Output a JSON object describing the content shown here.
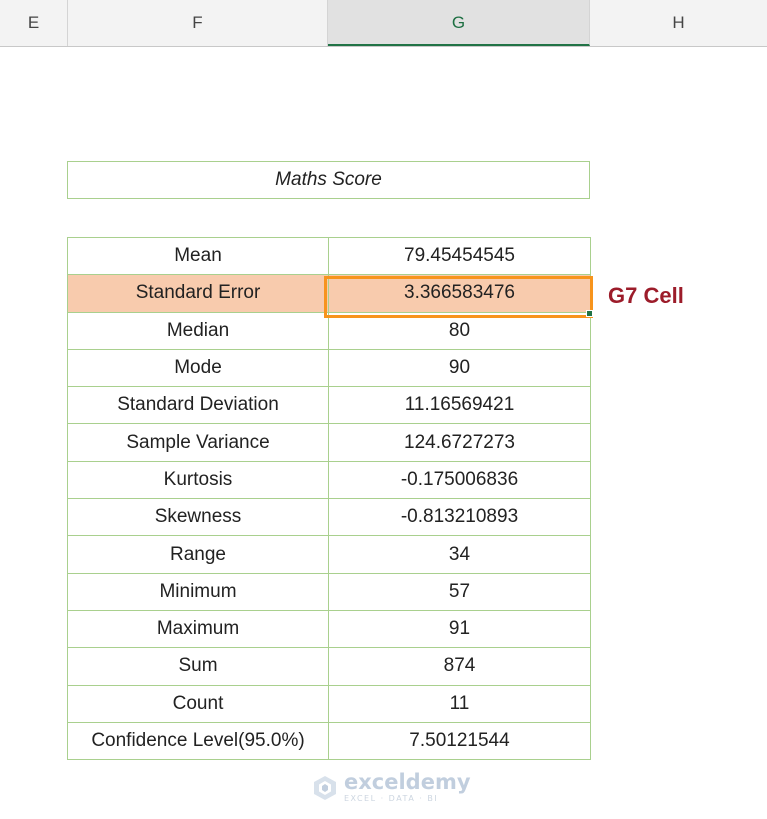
{
  "columns": {
    "e": "E",
    "f": "F",
    "g": "G",
    "h": "H"
  },
  "title": "Maths Score",
  "stats": [
    {
      "label": "Mean",
      "value": "79.45454545"
    },
    {
      "label": "Standard Error",
      "value": "3.366583476"
    },
    {
      "label": "Median",
      "value": "80"
    },
    {
      "label": "Mode",
      "value": "90"
    },
    {
      "label": "Standard Deviation",
      "value": "11.16569421"
    },
    {
      "label": "Sample Variance",
      "value": "124.6727273"
    },
    {
      "label": "Kurtosis",
      "value": "-0.175006836"
    },
    {
      "label": "Skewness",
      "value": "-0.813210893"
    },
    {
      "label": "Range",
      "value": "34"
    },
    {
      "label": "Minimum",
      "value": "57"
    },
    {
      "label": "Maximum",
      "value": "91"
    },
    {
      "label": "Sum",
      "value": "874"
    },
    {
      "label": "Count",
      "value": "11"
    },
    {
      "label": "Confidence Level(95.0%)",
      "value": "7.50121544"
    }
  ],
  "annotation": "G7 Cell",
  "watermark": {
    "brand": "exceldemy",
    "tagline": "EXCEL · DATA · BI",
    "icon": "exceldemy-logo-icon"
  },
  "colors": {
    "highlight_row": "#f8cbad",
    "selection_border": "#f7941d",
    "annotation": "#9c1c2a",
    "cell_border": "#a9d08e"
  }
}
